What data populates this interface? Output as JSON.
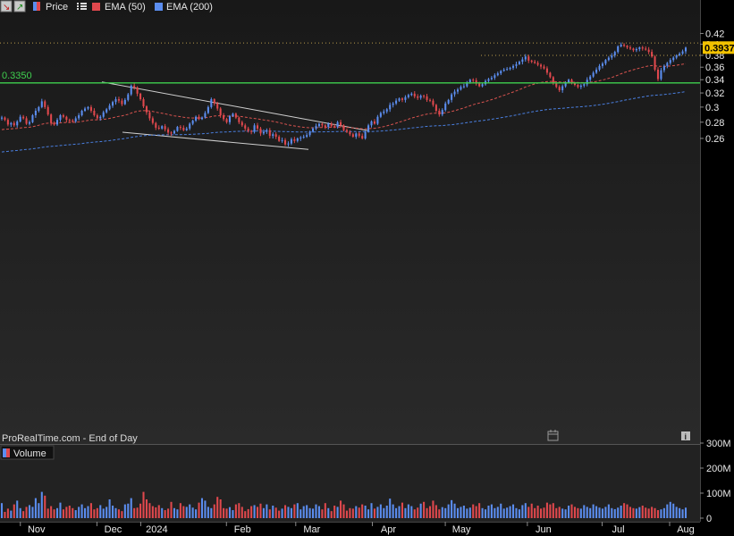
{
  "toolbar": {
    "price_label": "Price",
    "ema50_label": "EMA (50)",
    "ema200_label": "EMA (200)",
    "volume_label": "Volume",
    "colors": {
      "up": "#5b8def",
      "down": "#e0484d",
      "ema50": "#d9534f",
      "ema200": "#4a7fe0",
      "level": "#3fd04f"
    }
  },
  "watermark": "ProRealTime.com - End of Day",
  "chart_data": [
    {
      "type": "candlestick",
      "title": "",
      "x_ticks": [
        "Nov",
        "Dec",
        "2024",
        "Feb",
        "Mar",
        "Apr",
        "May",
        "Jun",
        "Jul",
        "Aug"
      ],
      "y_ticks": [
        "0.42",
        "0.4",
        "0.38",
        "0.36",
        "0.34",
        "0.32",
        "0.3",
        "0.28",
        "0.26"
      ],
      "ylim": [
        0.247,
        0.425
      ],
      "scale": "log",
      "last_price": "0.3937",
      "horizontal_level": {
        "label": "0.3350",
        "value": 0.335
      },
      "dotted_levels": [
        0.402,
        0.38
      ],
      "close": [
        0.286,
        0.283,
        0.277,
        0.279,
        0.276,
        0.281,
        0.287,
        0.285,
        0.278,
        0.28,
        0.289,
        0.295,
        0.3,
        0.308,
        0.3,
        0.29,
        0.279,
        0.277,
        0.283,
        0.289,
        0.287,
        0.283,
        0.282,
        0.281,
        0.285,
        0.289,
        0.295,
        0.298,
        0.3,
        0.295,
        0.289,
        0.285,
        0.287,
        0.293,
        0.297,
        0.302,
        0.307,
        0.311,
        0.309,
        0.304,
        0.31,
        0.318,
        0.331,
        0.328,
        0.319,
        0.311,
        0.301,
        0.293,
        0.285,
        0.279,
        0.273,
        0.272,
        0.275,
        0.271,
        0.267,
        0.266,
        0.269,
        0.274,
        0.273,
        0.27,
        0.272,
        0.278,
        0.282,
        0.287,
        0.284,
        0.286,
        0.292,
        0.3,
        0.311,
        0.305,
        0.298,
        0.289,
        0.284,
        0.28,
        0.288,
        0.291,
        0.286,
        0.28,
        0.276,
        0.272,
        0.269,
        0.268,
        0.276,
        0.272,
        0.266,
        0.268,
        0.27,
        0.263,
        0.265,
        0.262,
        0.257,
        0.258,
        0.253,
        0.254,
        0.259,
        0.257,
        0.26,
        0.261,
        0.262,
        0.264,
        0.268,
        0.272,
        0.275,
        0.278,
        0.276,
        0.274,
        0.278,
        0.275,
        0.274,
        0.28,
        0.276,
        0.27,
        0.268,
        0.265,
        0.262,
        0.266,
        0.263,
        0.26,
        0.268,
        0.276,
        0.281,
        0.278,
        0.287,
        0.292,
        0.294,
        0.297,
        0.303,
        0.305,
        0.309,
        0.312,
        0.31,
        0.314,
        0.317,
        0.319,
        0.315,
        0.313,
        0.316,
        0.315,
        0.31,
        0.309,
        0.303,
        0.295,
        0.29,
        0.296,
        0.305,
        0.31,
        0.318,
        0.322,
        0.325,
        0.329,
        0.33,
        0.336,
        0.34,
        0.339,
        0.334,
        0.33,
        0.333,
        0.338,
        0.341,
        0.343,
        0.347,
        0.35,
        0.354,
        0.356,
        0.357,
        0.359,
        0.362,
        0.365,
        0.369,
        0.373,
        0.378,
        0.371,
        0.369,
        0.367,
        0.364,
        0.361,
        0.358,
        0.351,
        0.344,
        0.334,
        0.329,
        0.324,
        0.33,
        0.336,
        0.34,
        0.335,
        0.332,
        0.329,
        0.331,
        0.333,
        0.34,
        0.345,
        0.351,
        0.356,
        0.362,
        0.366,
        0.372,
        0.376,
        0.38,
        0.386,
        0.396,
        0.399,
        0.397,
        0.394,
        0.392,
        0.389,
        0.391,
        0.394,
        0.392,
        0.39,
        0.386,
        0.378,
        0.356,
        0.341,
        0.355,
        0.362,
        0.367,
        0.372,
        0.376,
        0.38,
        0.383,
        0.387,
        0.3937
      ]
    },
    {
      "type": "bar",
      "title": "Volume",
      "ylabel": "Volume",
      "y_ticks": [
        "300M",
        "200M",
        "100M",
        "0"
      ],
      "ylim": [
        0,
        300000000
      ],
      "values_millions": [
        60,
        25,
        38,
        30,
        55,
        70,
        40,
        28,
        45,
        52,
        45,
        80,
        60,
        105,
        90,
        38,
        48,
        35,
        40,
        62,
        35,
        45,
        50,
        40,
        32,
        45,
        55,
        40,
        48,
        60,
        35,
        40,
        52,
        38,
        45,
        75,
        50,
        40,
        35,
        28,
        55,
        58,
        80,
        40,
        42,
        58,
        105,
        75,
        60,
        48,
        43,
        52,
        40,
        32,
        38,
        65,
        40,
        35,
        60,
        48,
        45,
        55,
        42,
        35,
        62,
        80,
        70,
        45,
        40,
        55,
        85,
        75,
        40,
        38,
        44,
        32,
        55,
        60,
        45,
        28,
        36,
        48,
        52,
        45,
        58,
        40,
        55,
        35,
        50,
        42,
        30,
        38,
        52,
        45,
        40,
        55,
        60,
        35,
        48,
        52,
        40,
        38,
        55,
        48,
        35,
        60,
        40,
        28,
        50,
        45,
        70,
        55,
        30,
        40,
        38,
        48,
        42,
        55,
        50,
        35,
        60,
        38,
        45,
        55,
        40,
        50,
        78,
        55,
        40,
        48,
        62,
        40,
        55,
        48,
        35,
        42,
        58,
        65,
        40,
        48,
        70,
        52,
        35,
        44,
        40,
        55,
        72,
        58,
        40,
        45,
        50,
        38,
        42,
        55,
        48,
        60,
        40,
        35,
        50,
        55,
        40,
        45,
        58,
        38,
        42,
        48,
        55,
        40,
        35,
        52,
        60,
        45,
        58,
        40,
        50,
        38,
        42,
        62,
        55,
        60,
        40,
        45,
        38,
        35,
        50,
        55,
        45,
        40,
        38,
        52,
        45,
        40,
        55,
        48,
        42,
        38,
        45,
        55,
        40,
        36,
        42,
        50,
        60,
        55,
        45,
        40,
        38,
        44,
        50,
        42,
        38,
        45,
        40,
        32,
        35,
        40,
        55,
        65,
        58,
        45,
        40,
        35,
        42,
        38,
        32,
        35,
        40,
        30,
        38,
        45
      ]
    }
  ]
}
